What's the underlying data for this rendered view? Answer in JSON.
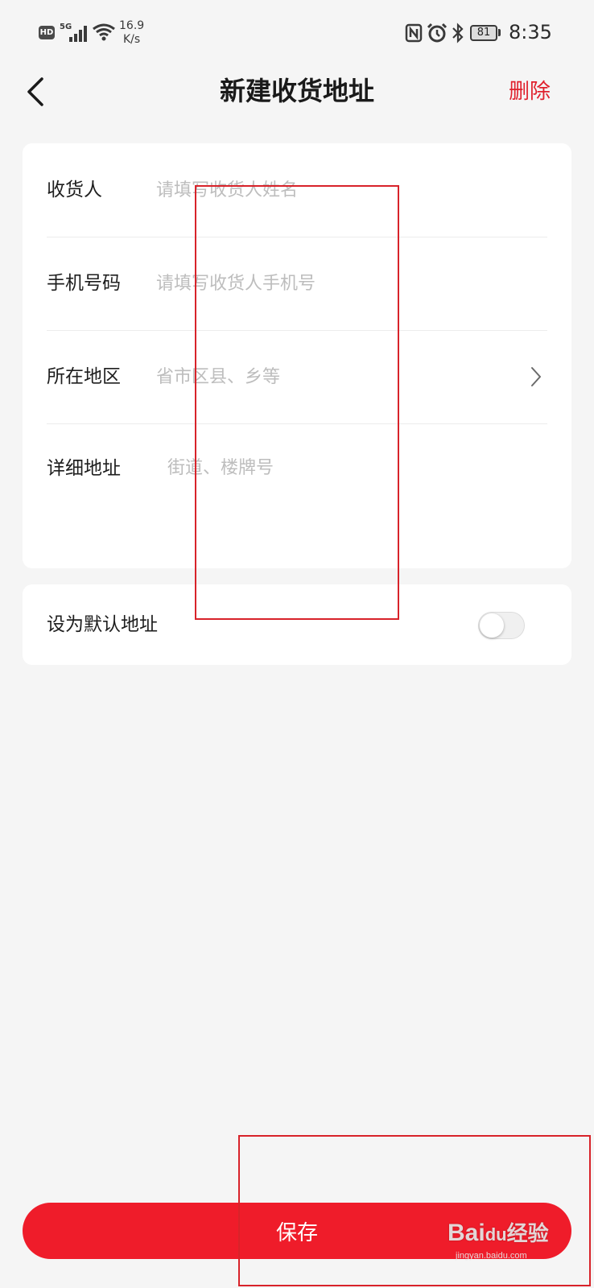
{
  "status_bar": {
    "hd": "HD",
    "network": "5G",
    "speed_value": "16.9",
    "speed_unit": "K/s",
    "battery": "81",
    "time": "8:35"
  },
  "nav": {
    "back_icon": "chevron-left-icon",
    "title": "新建收货地址",
    "delete_label": "删除"
  },
  "form": {
    "recipient": {
      "label": "收货人",
      "placeholder": "请填写收货人姓名",
      "value": ""
    },
    "phone": {
      "label": "手机号码",
      "placeholder": "请填写收货人手机号",
      "value": ""
    },
    "region": {
      "label": "所在地区",
      "placeholder": "省市区县、乡等",
      "value": "",
      "icon": "chevron-right-icon"
    },
    "detail": {
      "label": "详细地址",
      "placeholder": "街道、楼牌号",
      "value": ""
    }
  },
  "default_address": {
    "label": "设为默认地址",
    "enabled": false
  },
  "save_label": "保存",
  "colors": {
    "accent": "#ef1c2a",
    "delete_text": "#e0212d",
    "background": "#f5f5f5",
    "placeholder": "#bdbdbd",
    "annotation": "#d8232a"
  },
  "watermark": {
    "brand": "Bai",
    "brand_suffix": "du",
    "cn": "经验",
    "url": "jingyan.baidu.com"
  }
}
